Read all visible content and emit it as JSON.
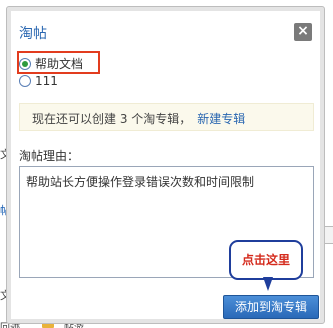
{
  "background": {
    "text1": "文",
    "text2": "帖",
    "text3": "文",
    "text4": "回迹",
    "text5": "帖游",
    "folder_icon": "folder-icon"
  },
  "dialog": {
    "title": "淘帖",
    "close_label": "×",
    "options": [
      {
        "label": "帮助文档",
        "selected": true
      },
      {
        "label": "111",
        "selected": false
      }
    ],
    "notice_text": "现在还可以创建 3 个淘专辑，",
    "notice_link": "新建专辑",
    "reason_label": "淘帖理由：",
    "reason_value": "帮助站长方便操作登录错误次数和时间限制",
    "callout_text": "点击这里",
    "submit_label": "添加到淘专辑",
    "colors": {
      "accent": "#2a67b1",
      "highlight_border": "#e23c1e",
      "callout_border": "#1f3e9c",
      "callout_text": "#d42a1c"
    }
  }
}
